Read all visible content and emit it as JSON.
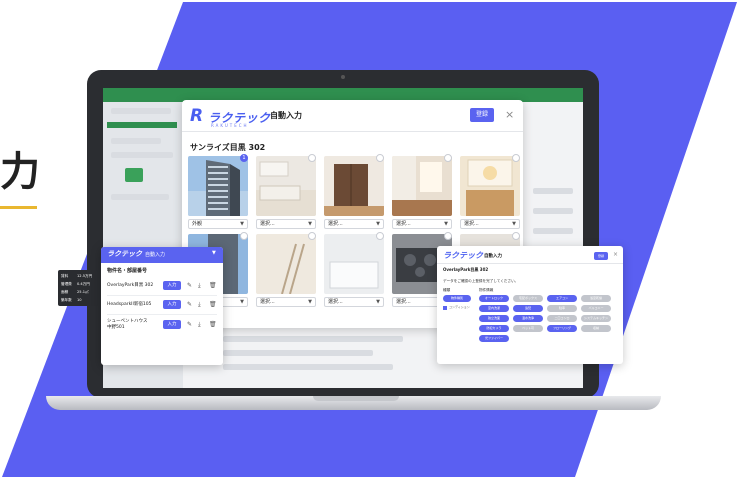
{
  "hero": {
    "heading_fragment": "力"
  },
  "colors": {
    "accent": "#5a63f0",
    "underline": "#e9b730",
    "shape": "#5a5ff2"
  },
  "brand": {
    "mark": "R",
    "name": "ラクテック",
    "sub": "RAKUTECH"
  },
  "modal": {
    "title": "自動入力",
    "register_label": "登録",
    "close_icon": "×",
    "property_name": "サンライズ目黒 302",
    "photos": [
      {
        "category": "外観",
        "checked": true,
        "check_label": "1"
      },
      {
        "category": "選択...",
        "checked": false,
        "check_label": ""
      },
      {
        "category": "選択...",
        "checked": false,
        "check_label": ""
      },
      {
        "category": "選択...",
        "checked": false,
        "check_label": ""
      },
      {
        "category": "選択...",
        "checked": false,
        "check_label": ""
      },
      {
        "category": "",
        "checked": false,
        "check_label": ""
      },
      {
        "category": "選択...",
        "checked": false,
        "check_label": ""
      },
      {
        "category": "選択...",
        "checked": false,
        "check_label": ""
      },
      {
        "category": "選択...",
        "checked": false,
        "check_label": ""
      },
      {
        "category": "",
        "checked": false,
        "check_label": ""
      }
    ]
  },
  "left_card": {
    "title": "自動入力",
    "section_title": "物件名・部屋番号",
    "input_label": "入力",
    "rows": [
      {
        "name": "OverlayPark目黒 302"
      },
      {
        "name": "HeadsparkII新宿105"
      },
      {
        "name": "シューペントハウス\n中野501"
      }
    ]
  },
  "tooltip": {
    "rows": [
      {
        "label": "賃料",
        "value": "12.5万円"
      },
      {
        "label": "管理費",
        "value": "0.4万円"
      },
      {
        "label": "面積",
        "value": "25.1㎡"
      },
      {
        "label": "築年数",
        "value": "10"
      }
    ]
  },
  "right_card": {
    "title": "自動入力",
    "register_label": "登録",
    "property": "OverlayPark目黒 302",
    "instruction": "データをご確認の上登録を完了してください。",
    "col_type": "種類",
    "col_features": "物件情報",
    "type_pill": "物件種別",
    "check_label": "コンディション",
    "feature_pills": [
      {
        "label": "オートロック",
        "on": true
      },
      {
        "label": "宅配ボックス",
        "on": false
      },
      {
        "label": "エアコン",
        "on": true
      },
      {
        "label": "浴室乾燥",
        "on": false
      },
      {
        "label": "室内洗濯",
        "on": true
      },
      {
        "label": "追焚",
        "on": true
      },
      {
        "label": "駐車",
        "on": false
      },
      {
        "label": "バルコニー",
        "on": false
      },
      {
        "label": "独立洗面",
        "on": true
      },
      {
        "label": "温水洗浄",
        "on": true
      },
      {
        "label": "二口コンロ",
        "on": false
      },
      {
        "label": "システムキッチン",
        "on": false
      },
      {
        "label": "防犯カメラ",
        "on": true
      },
      {
        "label": "ペット可",
        "on": false
      },
      {
        "label": "フローリング",
        "on": true
      },
      {
        "label": "収納",
        "on": false
      },
      {
        "label": "光ファイバー",
        "on": true
      }
    ]
  }
}
